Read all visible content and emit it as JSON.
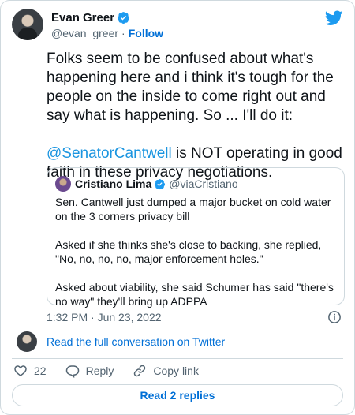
{
  "tweet": {
    "author": {
      "display_name": "Evan Greer",
      "handle": "@evan_greer",
      "follow_label": "Follow",
      "separator": "·"
    },
    "text_before": "Folks seem to be confused about what's happening here and i think it's tough for the people on the inside to come right out and say what is happening. So ... I'll do it:\n\n",
    "mention": "@SenatorCantwell",
    "text_after": " is NOT operating in good faith in these privacy negotiations.",
    "timestamp": "1:32 PM · Jun 23, 2022"
  },
  "quoted_tweet": {
    "display_name": "Cristiano Lima",
    "handle": "@viaCristiano",
    "text": "Sen. Cantwell just dumped a major bucket on cold water on the 3 corners privacy bill\n\nAsked if she thinks she's close to backing, she replied, \"No, no, no, no, major enforcement holes.\"\n\nAsked about viability, she said Schumer has said \"there's no way\" they'll bring up ADPPA"
  },
  "conversation_link": "Read the full conversation on Twitter",
  "actions": {
    "like_count": "22",
    "reply_label": "Reply",
    "copy_link_label": "Copy link"
  },
  "read_replies_label": "Read 2 replies",
  "colors": {
    "link_blue": "#006fd6",
    "mention_blue": "#1b95e0",
    "twitter_blue": "#1d9bf0",
    "muted_text": "#536471",
    "border": "#cfd9de"
  }
}
